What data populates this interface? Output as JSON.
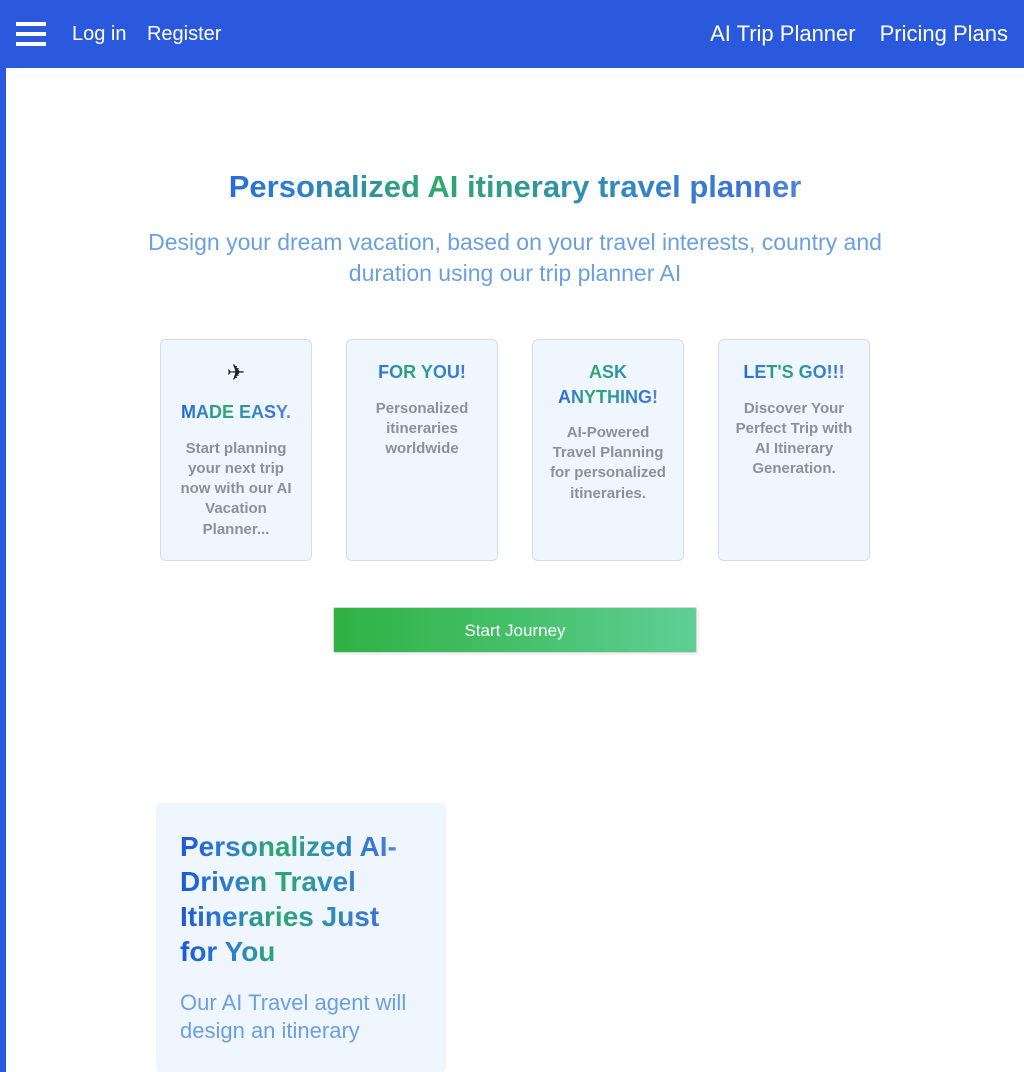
{
  "header": {
    "login": "Log in",
    "register": "Register",
    "nav1": "AI Trip Planner",
    "nav2": "Pricing Plans"
  },
  "hero": {
    "title": "Personalized AI itinerary travel planner",
    "subtitle": "Design your dream vacation, based on your travel interests, country and duration using our trip planner AI"
  },
  "cards": [
    {
      "icon": "✈",
      "title": "MADE EASY.",
      "desc": "Start planning your next trip now with our AI Vacation Planner..."
    },
    {
      "icon": "",
      "title": "FOR YOU!",
      "desc": "Personalized itineraries worldwide"
    },
    {
      "icon": "",
      "title": "ASK ANYTHING!",
      "desc": "AI-Powered Travel Planning for personalized itineraries."
    },
    {
      "icon": "",
      "title": "LET'S GO!!!",
      "desc": "Discover Your Perfect Trip with AI Itinerary Generation."
    }
  ],
  "cta": "Start Journey",
  "section2": {
    "title": "Personalized AI-Driven Travel Itineraries Just for You",
    "body": "Our AI Travel agent will design an itinerary"
  }
}
